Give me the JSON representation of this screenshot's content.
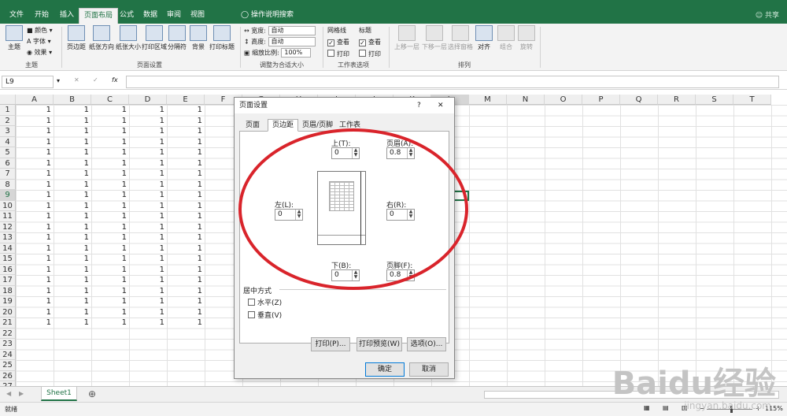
{
  "title_bar": {
    "share": "共享",
    "accent": "#217346"
  },
  "menu_tabs": [
    "文件",
    "开始",
    "插入",
    "页面布局",
    "公式",
    "数据",
    "审阅",
    "视图"
  ],
  "tell_me": "操作说明搜索",
  "ribbon": {
    "theme": {
      "themes": "主题",
      "colors": "颜色",
      "fonts": "字体",
      "effects": "效果",
      "group": "主题"
    },
    "page_setup": {
      "margins": "页边距",
      "orientation": "纸张方向",
      "size": "纸张大小",
      "print_area": "打印区域",
      "breaks": "分隔符",
      "background": "背景",
      "print_titles": "打印标题",
      "group": "页面设置"
    },
    "scale": {
      "width_label": "宽度:",
      "width_value": "自动",
      "height_label": "高度:",
      "height_value": "自动",
      "scale_label": "缩放比例:",
      "scale_value": "100%",
      "group": "调整为合适大小"
    },
    "sheet_options": {
      "gridlines": "网格线",
      "headings": "标题",
      "view": "查看",
      "print": "打印",
      "group": "工作表选项"
    },
    "arrange": {
      "bring_forward": "上移一层",
      "send_backward": "下移一层",
      "selection_pane": "选择窗格",
      "align": "对齐",
      "group_btn": "组合",
      "rotate": "旋转",
      "group": "排列"
    }
  },
  "formula_bar": {
    "name_box": "L9",
    "fx": "fx",
    "value": ""
  },
  "columns": [
    "A",
    "B",
    "C",
    "D",
    "E",
    "F",
    "G",
    "H",
    "I",
    "J",
    "K",
    "L",
    "M",
    "N",
    "O",
    "P",
    "Q",
    "R",
    "S",
    "T"
  ],
  "rows": [
    "1",
    "2",
    "3",
    "4",
    "5",
    "6",
    "7",
    "8",
    "9",
    "10",
    "11",
    "12",
    "13",
    "14",
    "15",
    "16",
    "17",
    "18",
    "19",
    "20",
    "21",
    "22",
    "23",
    "24",
    "25",
    "26",
    "27"
  ],
  "cell_value": "1",
  "sheet_tab": "Sheet1",
  "status": {
    "ready": "就绪",
    "zoom": "115%"
  },
  "dialog": {
    "title": "页面设置",
    "help": "?",
    "close": "✕",
    "tabs": [
      "页面",
      "页边距",
      "页眉/页脚",
      "工作表"
    ],
    "top_label": "上(T):",
    "top_value": "0",
    "header_label": "页眉(A):",
    "header_value": "0.8",
    "left_label": "左(L):",
    "left_value": "0",
    "right_label": "右(R):",
    "right_value": "0",
    "bottom_label": "下(B):",
    "bottom_value": "0",
    "footer_label": "页脚(F):",
    "footer_value": "0.8",
    "center_title": "居中方式",
    "horizontal": "水平(Z)",
    "vertical": "垂直(V)",
    "print_btn": "打印(P)...",
    "preview_btn": "打印预览(W)",
    "options_btn": "选项(O)...",
    "ok_btn": "确定",
    "cancel_btn": "取消"
  },
  "watermark": {
    "brand": "Baidu经验",
    "url": "jingyan.baidu.com"
  },
  "annotation_color": "#d9242b"
}
